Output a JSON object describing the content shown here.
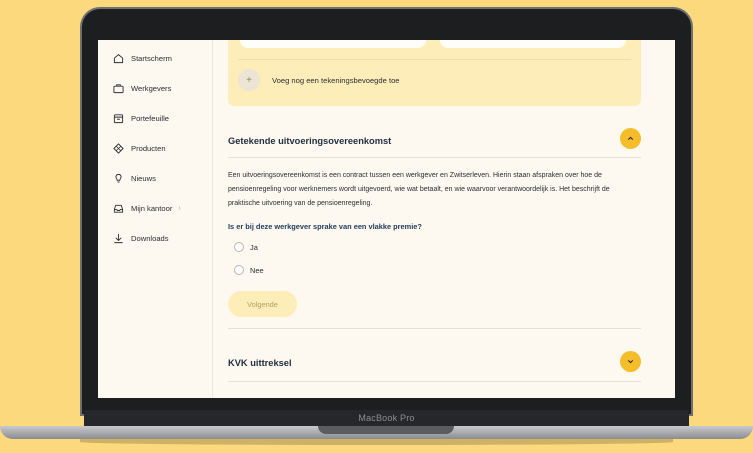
{
  "device": {
    "label": "MacBook Pro"
  },
  "sidebar": {
    "items": [
      {
        "label": "Startscherm",
        "icon": "home-icon"
      },
      {
        "label": "Werkgevers",
        "icon": "briefcase-icon"
      },
      {
        "label": "Portefeuille",
        "icon": "folder-icon"
      },
      {
        "label": "Producten",
        "icon": "diamond-grid-icon"
      },
      {
        "label": "Nieuws",
        "icon": "lightbulb-icon"
      },
      {
        "label": "Mijn kantoor",
        "icon": "inbox-icon",
        "has_submenu": true
      },
      {
        "label": "Downloads",
        "icon": "download-icon"
      }
    ]
  },
  "authorized_signers": {
    "add_label": "Voeg nog een tekeningsbevoegde toe"
  },
  "signed_agreement": {
    "title": "Getekende uitvoeringsovereenkomst",
    "expanded": true,
    "description": "Een uitvoeringsovereenkomst is een contract tussen een werkgever en Zwitserleven. Hierin staan afspraken over hoe de pensioenregeling voor werknemers wordt uitgevoerd, wie wat betaalt, en wie waarvoor verantwoordelijk is. Het beschrijft de praktische uitvoering van de pensioenregeling.",
    "question": "Is er bij deze werkgever sprake van een vlakke premie?",
    "options": [
      "Ja",
      "Nee"
    ],
    "next_label": "Volgende"
  },
  "kvk": {
    "title": "KVK uittreksel",
    "expanded": false
  },
  "colors": {
    "accent": "#f5bd2a",
    "panel": "#fdedb8",
    "background": "#fbd97c"
  }
}
